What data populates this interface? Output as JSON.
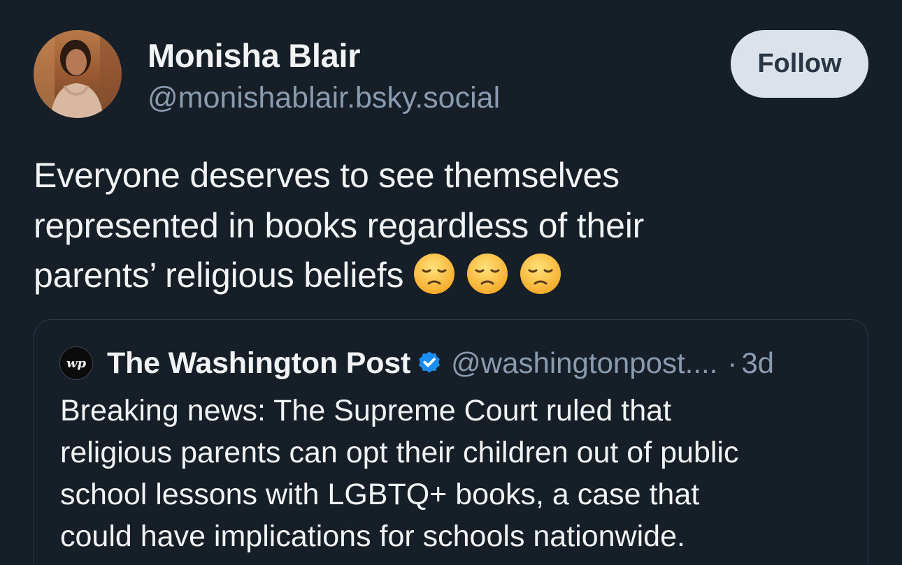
{
  "author": {
    "name": "Monisha Blair",
    "handle": "@monishablair.bsky.social",
    "avatar_icon": "user-avatar-photo"
  },
  "follow_button": {
    "label": "Follow"
  },
  "post": {
    "text_lines": [
      "Everyone deserves to see themselves",
      "represented in books regardless of their",
      "parents’ religious beliefs"
    ],
    "emojis": [
      "disappointed-face-emoji",
      "disappointed-face-emoji",
      "disappointed-face-emoji"
    ]
  },
  "quote": {
    "logo_text": "wp",
    "name": "The Washington Post",
    "verified_icon": "verified-badge-icon",
    "handle": "@washingtonpost....",
    "dot": "·",
    "time": "3d",
    "text_lines": [
      "Breaking news: The Supreme Court ruled that",
      "religious parents can opt their children out of public",
      "school lessons with LGBTQ+ books, a case that",
      "could have implications for schools nationwide."
    ]
  },
  "colors": {
    "background": "#161e27",
    "handle_gray": "#8a9bb0",
    "follow_bg": "#dce2ea",
    "verified_blue": "#1d8cf0"
  }
}
